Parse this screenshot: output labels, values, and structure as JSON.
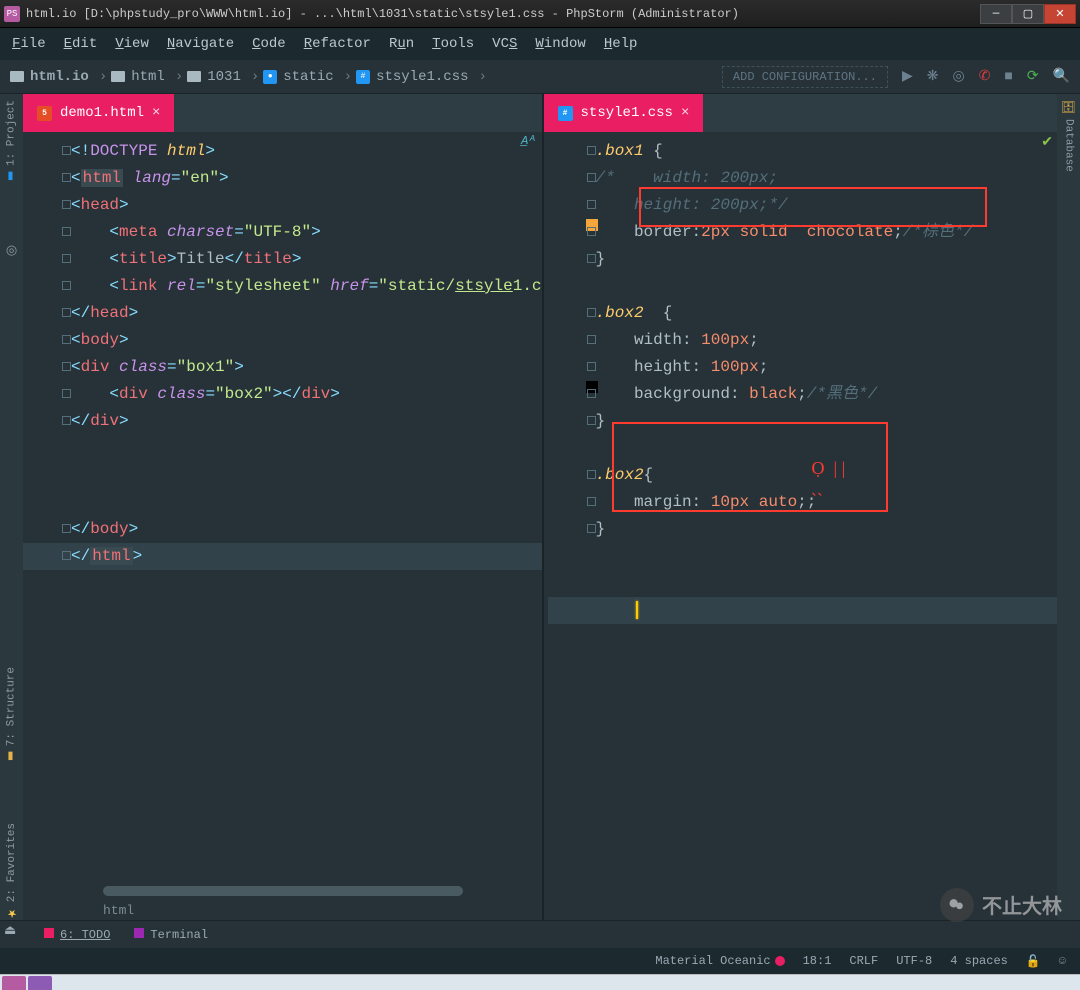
{
  "title": "html.io [D:\\phpstudy_pro\\WWW\\html.io] - ...\\html\\1031\\static\\stsyle1.css - PhpStorm (Administrator)",
  "menu": [
    "File",
    "Edit",
    "View",
    "Navigate",
    "Code",
    "Refactor",
    "Run",
    "Tools",
    "VCS",
    "Window",
    "Help"
  ],
  "breadcrumbs": [
    "html.io",
    "html",
    "1031",
    "static",
    "stsyle1.css"
  ],
  "run_placeholder": "ADD CONFIGURATION...",
  "left_tabs": {
    "project": "1: Project",
    "structure": "7: Structure",
    "favorites": "2: Favorites"
  },
  "right_tabs": {
    "database": "Database"
  },
  "editor_left": {
    "tab": "demo1.html",
    "bottom_crumb": "html",
    "lines": [
      {
        "tokens": [
          [
            "punc",
            "<!"
          ],
          [
            "doctype-kw",
            "DOCTYPE "
          ],
          [
            "doctype-t",
            "html"
          ],
          [
            "punc",
            ">"
          ]
        ]
      },
      {
        "tokens": [
          [
            "punc",
            "<"
          ],
          [
            "tag",
            "html",
            "hi"
          ],
          [
            "attr",
            " lang"
          ],
          [
            "punc",
            "="
          ],
          [
            "str",
            "\"en\""
          ],
          [
            "punc",
            ">"
          ]
        ]
      },
      {
        "tokens": [
          [
            "punc",
            "<"
          ],
          [
            "tag",
            "head"
          ],
          [
            "punc",
            ">"
          ]
        ]
      },
      {
        "indent": 2,
        "tokens": [
          [
            "punc",
            "<"
          ],
          [
            "tag",
            "meta "
          ],
          [
            "attr",
            "charset"
          ],
          [
            "punc",
            "="
          ],
          [
            "str",
            "\"UTF-8\""
          ],
          [
            "punc",
            ">"
          ]
        ]
      },
      {
        "indent": 2,
        "tokens": [
          [
            "punc",
            "<"
          ],
          [
            "tag",
            "title"
          ],
          [
            "punc",
            ">"
          ],
          [
            "prop",
            "Title"
          ],
          [
            "punc",
            "</"
          ],
          [
            "tag",
            "title"
          ],
          [
            "punc",
            ">"
          ]
        ]
      },
      {
        "indent": 2,
        "tokens": [
          [
            "punc",
            "<"
          ],
          [
            "tag",
            "link "
          ],
          [
            "attr",
            "rel"
          ],
          [
            "punc",
            "="
          ],
          [
            "str",
            "\"stylesheet\" "
          ],
          [
            "attr",
            "href"
          ],
          [
            "punc",
            "="
          ],
          [
            "str",
            "\"static/"
          ],
          [
            "str",
            "stsyle",
            "u"
          ],
          [
            "str",
            "1.c"
          ]
        ]
      },
      {
        "tokens": [
          [
            "punc",
            "</"
          ],
          [
            "tag",
            "head"
          ],
          [
            "punc",
            ">"
          ]
        ]
      },
      {
        "tokens": [
          [
            "punc",
            "<"
          ],
          [
            "tag",
            "body"
          ],
          [
            "punc",
            ">"
          ]
        ]
      },
      {
        "tokens": [
          [
            "punc",
            "<"
          ],
          [
            "tag",
            "div "
          ],
          [
            "attr",
            "class"
          ],
          [
            "punc",
            "="
          ],
          [
            "str",
            "\"box1\""
          ],
          [
            "punc",
            ">"
          ]
        ]
      },
      {
        "indent": 2,
        "tokens": [
          [
            "punc",
            "<"
          ],
          [
            "tag",
            "div "
          ],
          [
            "attr",
            "class"
          ],
          [
            "punc",
            "="
          ],
          [
            "str",
            "\"box2\""
          ],
          [
            "punc",
            "></"
          ],
          [
            "tag",
            "div"
          ],
          [
            "punc",
            ">"
          ]
        ]
      },
      {
        "tokens": [
          [
            "punc",
            "</"
          ],
          [
            "tag",
            "div"
          ],
          [
            "punc",
            ">"
          ]
        ]
      },
      {
        "blank": true
      },
      {
        "blank": true
      },
      {
        "blank": true
      },
      {
        "tokens": [
          [
            "punc",
            "</"
          ],
          [
            "tag",
            "body"
          ],
          [
            "punc",
            ">"
          ]
        ]
      },
      {
        "hl": true,
        "tokens": [
          [
            "punc",
            "</"
          ],
          [
            "tag",
            "html",
            "hi"
          ],
          [
            "punc",
            ">"
          ]
        ]
      }
    ]
  },
  "editor_right": {
    "tab": "stsyle1.css",
    "lines": [
      {
        "tokens": [
          [
            "sel",
            ".box1"
          ],
          [
            "prop",
            " {"
          ]
        ]
      },
      {
        "tokens": [
          [
            "comment",
            "/*    width: 200px;"
          ]
        ]
      },
      {
        "tokens": [
          [
            "comment",
            "    height: 200px;*/"
          ]
        ]
      },
      {
        "marker": "orange",
        "tokens": [
          [
            "prop",
            "    border:"
          ],
          [
            "val",
            "2px solid  chocolate"
          ],
          [
            "prop",
            ";"
          ],
          [
            "comment",
            "/*棕色*/"
          ]
        ]
      },
      {
        "tokens": [
          [
            "prop",
            "}"
          ]
        ]
      },
      {
        "blank": true
      },
      {
        "tokens": [
          [
            "sel",
            ".box2"
          ],
          [
            "prop",
            "  {"
          ]
        ]
      },
      {
        "tokens": [
          [
            "prop",
            "    width: "
          ],
          [
            "val",
            "100px"
          ],
          [
            "prop",
            ";"
          ]
        ]
      },
      {
        "tokens": [
          [
            "prop",
            "    height: "
          ],
          [
            "val",
            "100px"
          ],
          [
            "prop",
            ";"
          ]
        ]
      },
      {
        "marker": "black",
        "tokens": [
          [
            "prop",
            "    background: "
          ],
          [
            "val",
            "black"
          ],
          [
            "prop",
            ";"
          ],
          [
            "comment",
            "/*黑色*/"
          ]
        ]
      },
      {
        "tokens": [
          [
            "prop",
            "}"
          ]
        ]
      },
      {
        "blank": true
      },
      {
        "tokens": [
          [
            "sel",
            ".box2"
          ],
          [
            "prop",
            "{"
          ]
        ]
      },
      {
        "tokens": [
          [
            "prop",
            "    margin: "
          ],
          [
            "val",
            "10px auto"
          ],
          [
            "prop",
            ";;"
          ]
        ]
      },
      {
        "tokens": [
          [
            "prop",
            "}"
          ]
        ]
      },
      {
        "blank": true
      },
      {
        "blank": true
      },
      {
        "cursor": true
      }
    ]
  },
  "bottom_tools": {
    "todo": "6: TODO",
    "terminal": "Terminal"
  },
  "status": {
    "theme": "Material Oceanic",
    "pos": "18:1",
    "sep": "CRLF",
    "enc": "UTF-8",
    "indent": "4 spaces"
  },
  "watermark_text": "不止大林"
}
